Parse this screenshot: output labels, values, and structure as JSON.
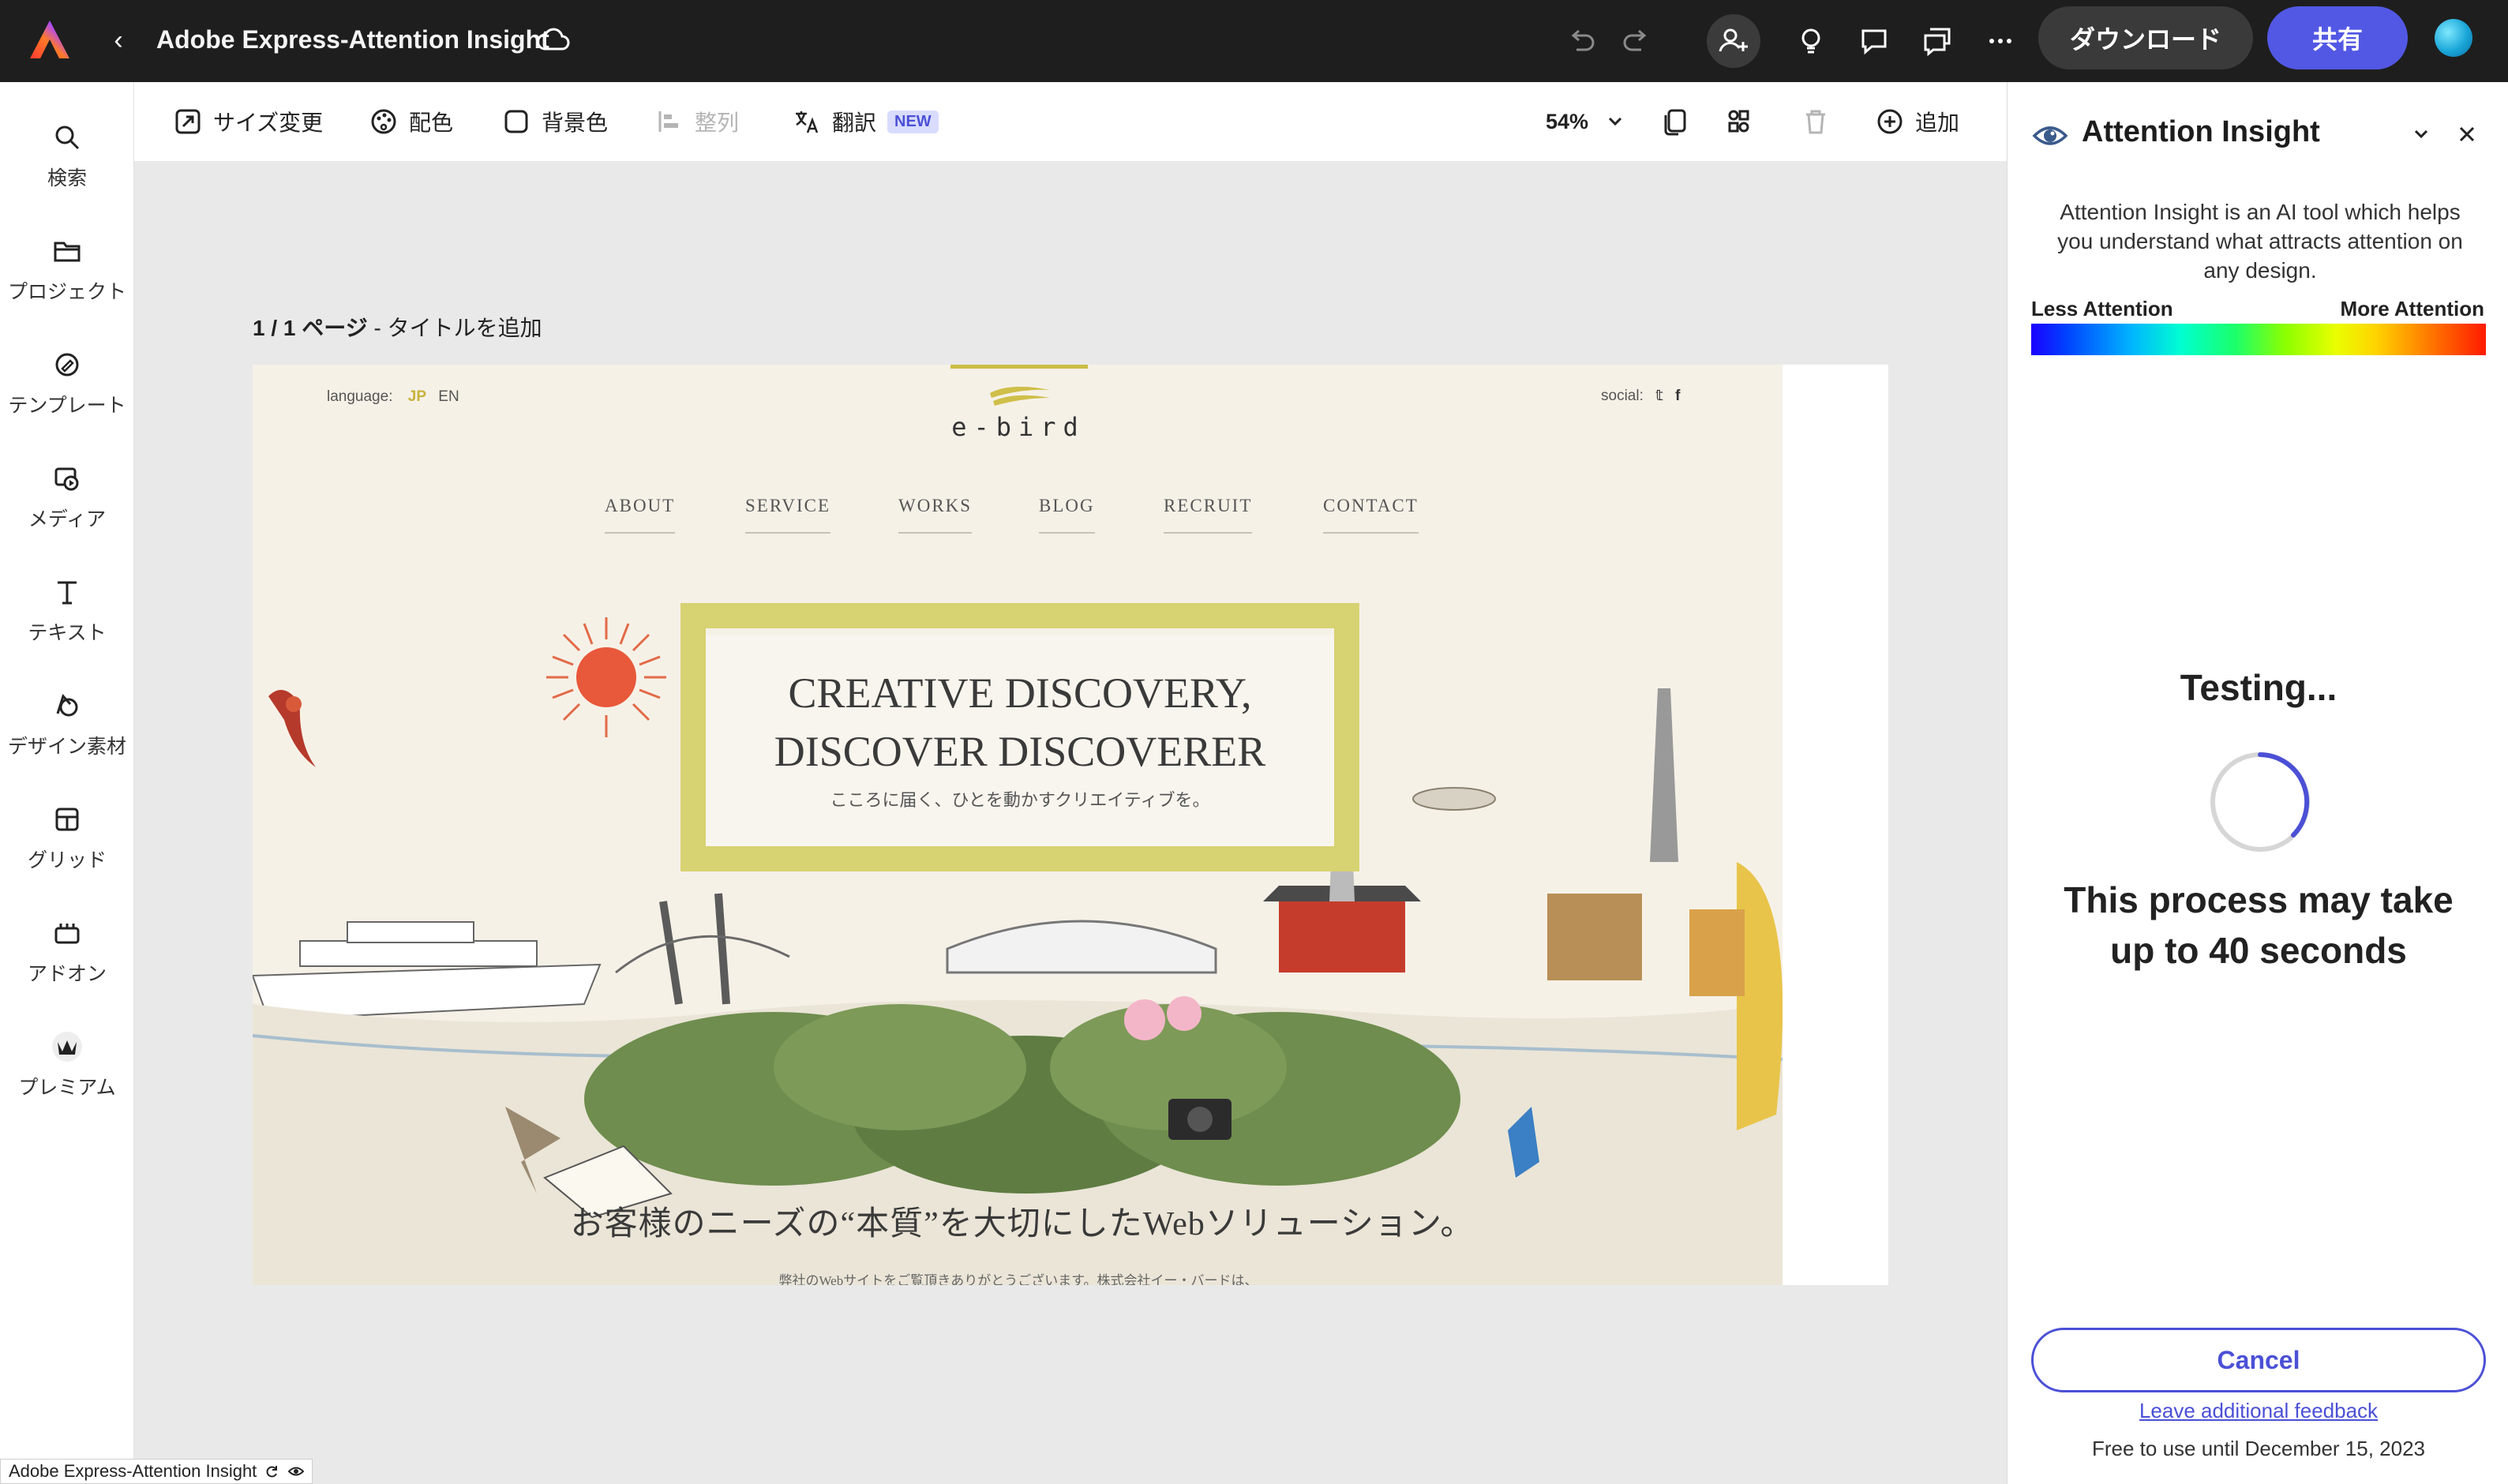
{
  "topbar": {
    "title": "Adobe Express-Attention Insight",
    "download_label": "ダウンロード",
    "share_label": "共有"
  },
  "leftrail": {
    "items": [
      {
        "label": "検索",
        "icon": "search-icon"
      },
      {
        "label": "プロジェクト",
        "icon": "folder-icon"
      },
      {
        "label": "テンプレート",
        "icon": "template-icon"
      },
      {
        "label": "メディア",
        "icon": "media-icon"
      },
      {
        "label": "テキスト",
        "icon": "text-icon"
      },
      {
        "label": "デザイン素材",
        "icon": "shapes-icon"
      },
      {
        "label": "グリッド",
        "icon": "grid-icon"
      },
      {
        "label": "アドオン",
        "icon": "addon-icon"
      },
      {
        "label": "プレミアム",
        "icon": "premium-crown-icon"
      }
    ]
  },
  "toolbar": {
    "resize": "サイズ変更",
    "color": "配色",
    "background": "背景色",
    "align": "整列",
    "translate": "翻訳",
    "translate_badge": "NEW",
    "zoom": "54%",
    "add": "追加"
  },
  "canvas": {
    "page_count": "1 / 1 ページ",
    "page_title": "- タイトルを追加"
  },
  "website": {
    "language_label": "language:",
    "lang_jp": "JP",
    "lang_en": "EN",
    "social_label": "social:",
    "logo": "e-bird",
    "nav": [
      "ABOUT",
      "SERVICE",
      "WORKS",
      "BLOG",
      "RECRUIT",
      "CONTACT"
    ],
    "hero_line1": "CREATIVE DISCOVERY,",
    "hero_line2": "DISCOVER DISCOVERER",
    "hero_sub": "こころに届く、ひとを動かすクリエイティブを。",
    "tagline": "お客様のニーズの“本質”を大切にしたWebソリューション。",
    "tagline_small": "弊社のWebサイトをご覧頂きありがとうございます。株式会社イー・バードは、"
  },
  "panel": {
    "title": "Attention Insight",
    "description": "Attention Insight is an AI tool which helps you understand what attracts attention on any design.",
    "less_attention": "Less Attention",
    "more_attention": "More Attention",
    "testing": "Testing...",
    "process_note": "This process may take up to 40 seconds",
    "cancel": "Cancel",
    "feedback": "Leave additional feedback",
    "free_until": "Free to use until December 15, 2023"
  },
  "bottom_tab": {
    "label": "Adobe Express-Attention Insight"
  },
  "colors": {
    "accent": "#5258e4",
    "topbar": "#1e1e1e",
    "hero_frame": "#d7d272",
    "site_bg": "#f6f1e7"
  }
}
